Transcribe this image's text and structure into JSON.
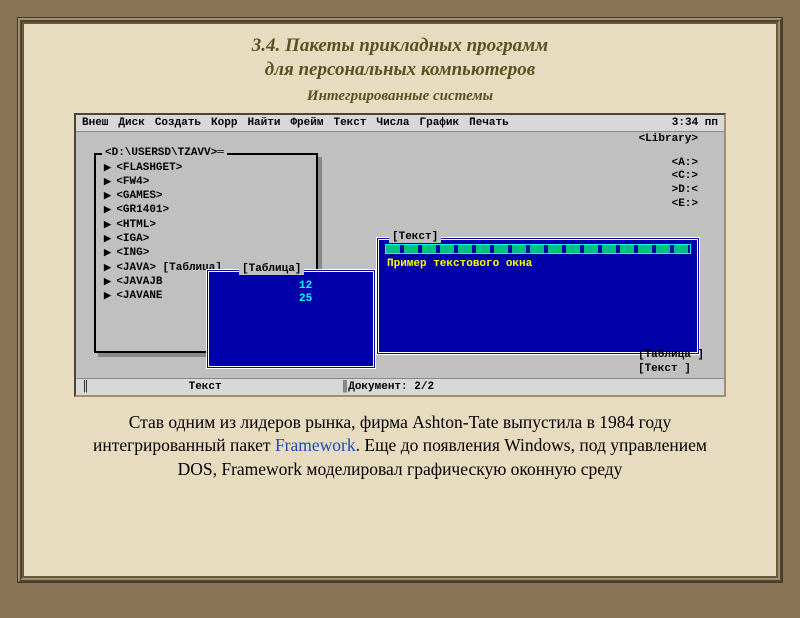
{
  "slide": {
    "title_line1": "3.4. Пакеты прикладных программ",
    "title_line2": "для персональных компьютеров",
    "subtitle": "Интегрированные системы"
  },
  "menu": {
    "items": [
      "Внеш",
      "Диск",
      "Создать",
      "Корр",
      "Найти",
      "Фрейм",
      "Текст",
      "Числа",
      "График",
      "Печать"
    ],
    "time": "3:34 пп"
  },
  "library_tag": "<Library>",
  "drives": [
    "<A:>",
    "<C:>",
    ">D:<",
    "<E:>"
  ],
  "tree": {
    "path_title": "<D:\\USERSD\\TZAVV>═",
    "items": [
      "<FLASHGET>",
      "<FW4>",
      "<GAMES>",
      "<GR1401>",
      "<HTML>",
      "<IGA>",
      "<ING>",
      "<JAVA> [Таблица]",
      "<JAVAJB",
      "<JAVANE"
    ]
  },
  "table_window": {
    "title": "[Таблица]",
    "val1": "12",
    "val2": "25"
  },
  "text_window": {
    "title": "[Текст]",
    "content": "Пример текстового окна"
  },
  "bottom_tags": {
    "tag1": "[Таблица ]",
    "tag2": "[Текст   ]"
  },
  "status": {
    "center": "Текст",
    "right": "║Документ: 2/2"
  },
  "caption": {
    "t1": "Став одним из лидеров рынка, фирма Ashton-Tate выпустила в  1984 году  интегрированный пакет ",
    "hl": "Framework",
    "t2": ". Еще до появления Windows, под управлением DOS,  Framework моделировал графическую оконную среду"
  }
}
